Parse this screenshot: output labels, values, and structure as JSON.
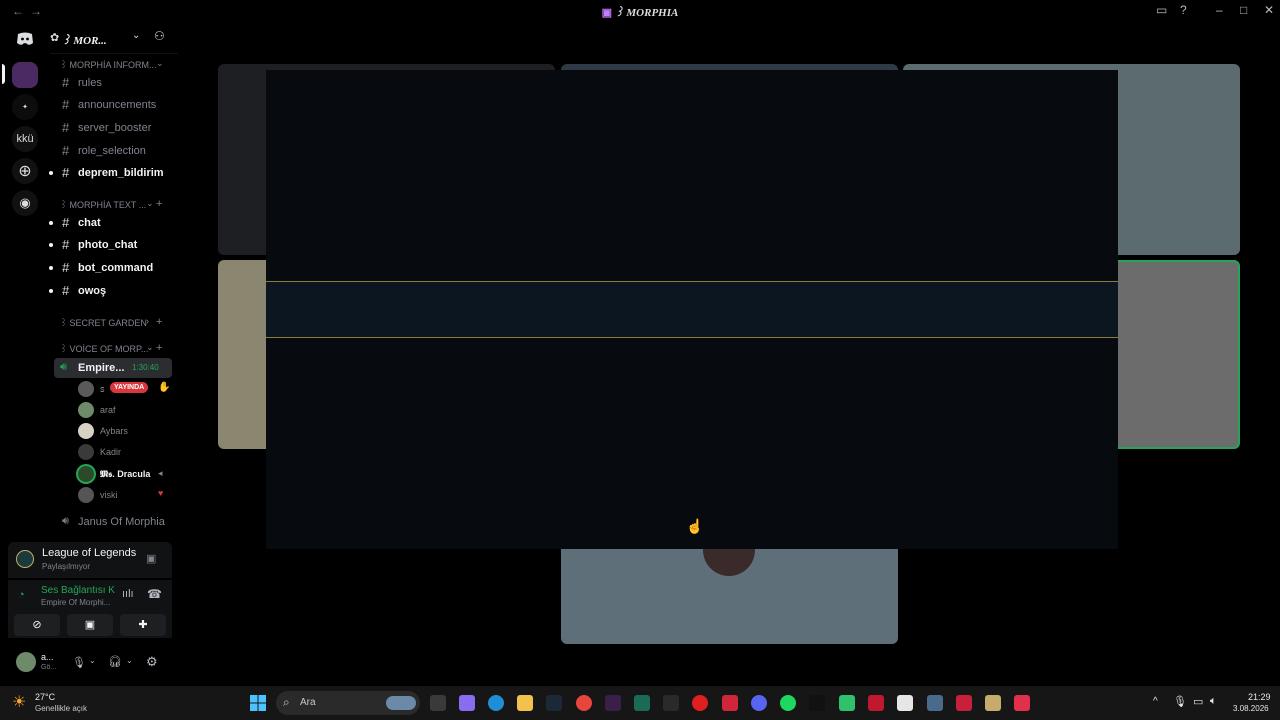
{
  "window": {
    "title": "꒱ MORPHIA",
    "title_icon": "server-icon",
    "controls": [
      "inbox-icon",
      "help-icon",
      "minimize-icon",
      "maximize-icon",
      "close-icon"
    ]
  },
  "guilds": {
    "items": [
      {
        "name": "discord-home-icon",
        "label": ""
      },
      {
        "name": "server-morphia",
        "label": ""
      },
      {
        "name": "server-2",
        "label": ""
      },
      {
        "name": "server-kku",
        "label": "kkü"
      },
      {
        "name": "add-server-icon",
        "label": "+"
      },
      {
        "name": "discover-icon",
        "label": ""
      }
    ]
  },
  "server": {
    "name": "꒱ MOR...",
    "categories": [
      {
        "label": "꒱ MORPHİA INFORM...",
        "channels": [
          {
            "name": "rules",
            "unread": false
          },
          {
            "name": "announcements",
            "unread": false
          },
          {
            "name": "server_booster",
            "unread": false
          },
          {
            "name": "role_selection",
            "unread": false
          },
          {
            "name": "deprem_bildirim",
            "unread": true
          }
        ]
      },
      {
        "label": "꒱ MORPHİA TEXT ...",
        "channels": [
          {
            "name": "chat",
            "unread": true
          },
          {
            "name": "photo_chat",
            "unread": true
          },
          {
            "name": "bot_command",
            "unread": true
          },
          {
            "name": "owoş",
            "unread": true
          }
        ]
      },
      {
        "label": "꒱ SECRET GARDEN",
        "channels": []
      },
      {
        "label": "꒱ VOİCE OF MORP...",
        "channels": []
      }
    ],
    "voice_channel": {
      "name": "Empire...",
      "time": "1:30:40",
      "users": [
        {
          "name": "ꜱ",
          "live": true,
          "live_label": "YAYINDA",
          "avatar_color": "#5a5a5a"
        },
        {
          "name": "araf",
          "live": false,
          "avatar_color": "#6f8a6a"
        },
        {
          "name": "Aybars",
          "live": false,
          "avatar_color": "#d8d2c4"
        },
        {
          "name": "Kadir",
          "live": false,
          "avatar_color": "#3a3a3a"
        },
        {
          "name": "𝕸𝖘. Dracula",
          "live": false,
          "avatar_color": "#2b4a2a"
        },
        {
          "name": "viski",
          "live": false,
          "avatar_color": "#555"
        }
      ]
    },
    "other_voice": "Janus Of Morphia"
  },
  "activity": {
    "game": "League of Legends",
    "status": "Paylaşılmıyor"
  },
  "rtc": {
    "status": "Ses Bağlantısı K",
    "channel": "Empire Of Morphi..."
  },
  "user": {
    "name": "a...",
    "status": "Gö..."
  },
  "taskbar": {
    "weather_temp": "27°C",
    "weather_desc": "Genellikle açık",
    "search_placeholder": "Ara",
    "time": "21:29",
    "date": "3.08.2026"
  },
  "colors": {
    "accent_green": "#23a55a",
    "live_red": "#da373c",
    "overlay_bg": "#070b0f",
    "band_border": "#8a7e3a"
  }
}
